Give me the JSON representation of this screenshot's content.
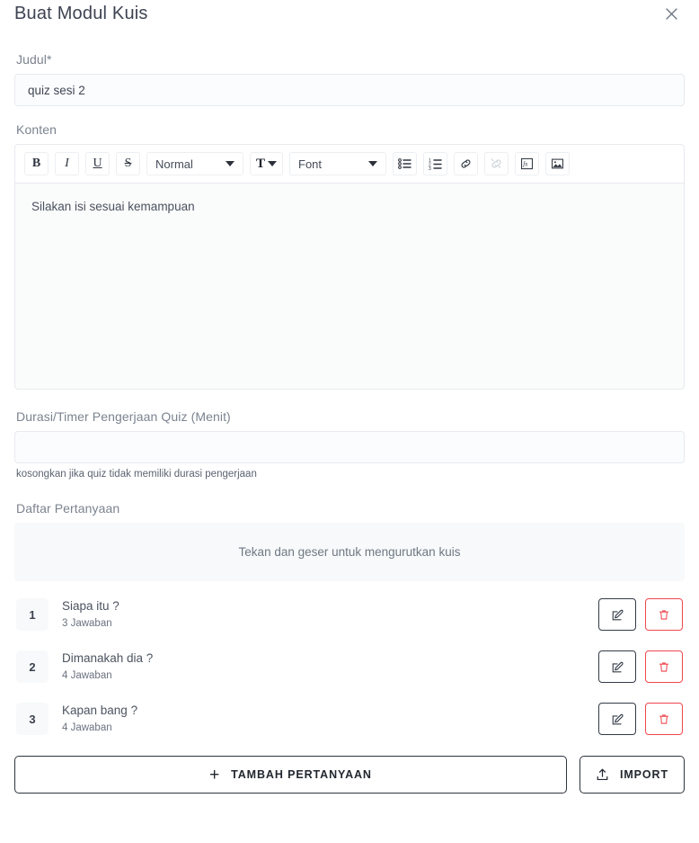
{
  "header": {
    "title": "Buat Modul Kuis",
    "close_label": "×",
    "close_icon": "close-icon"
  },
  "form": {
    "title_field": {
      "label": "Judul*",
      "value": "quiz sesi 2",
      "placeholder": ""
    },
    "content_field": {
      "label": "Konten",
      "value": "Silakan isi sesuai kemampuan"
    },
    "duration_field": {
      "label": "Durasi/Timer Pengerjaan Quiz (Menit)",
      "value": "",
      "placeholder": "",
      "helper": "kosongkan jika quiz tidak memiliki durasi pengerjaan"
    }
  },
  "editor_toolbar": {
    "bold": {
      "label": "B",
      "icon": "bold-icon"
    },
    "italic": {
      "label": "I",
      "icon": "italic-icon"
    },
    "underline": {
      "label": "U",
      "icon": "underline-icon"
    },
    "strike": {
      "label": "S",
      "icon": "strikethrough-icon"
    },
    "heading_select": {
      "value": "Normal",
      "icon": "chevron-down-icon"
    },
    "text_color": {
      "label": "T",
      "icon": "text-color-icon"
    },
    "font_select": {
      "value": "Font",
      "icon": "chevron-down-icon"
    },
    "bullet_list": {
      "icon": "bullet-list-icon"
    },
    "ordered_list": {
      "icon": "ordered-list-icon"
    },
    "link": {
      "icon": "link-icon"
    },
    "unlink": {
      "icon": "unlink-icon",
      "disabled": true
    },
    "formula": {
      "icon": "formula-icon"
    },
    "image": {
      "icon": "image-icon"
    }
  },
  "questions_section": {
    "label": "Daftar Pertanyaan",
    "drag_hint": "Tekan dan geser untuk mengurutkan kuis",
    "items": [
      {
        "number": "1",
        "title": "Siapa itu ?",
        "answers": "3 Jawaban",
        "edit_icon": "edit-icon",
        "delete_icon": "trash-icon"
      },
      {
        "number": "2",
        "title": "Dimanakah dia ?",
        "answers": "4 Jawaban",
        "edit_icon": "edit-icon",
        "delete_icon": "trash-icon"
      },
      {
        "number": "3",
        "title": "Kapan bang ?",
        "answers": "4 Jawaban",
        "edit_icon": "edit-icon",
        "delete_icon": "trash-icon"
      }
    ]
  },
  "footer": {
    "add_question": {
      "label": "TAMBAH PERTANYAAN",
      "icon": "plus-icon"
    },
    "import": {
      "label": "IMPORT",
      "icon": "upload-icon"
    }
  },
  "colors": {
    "title": "#3d4352",
    "label": "#7b838f",
    "danger": "#f0474f",
    "dark": "#2d333d",
    "surface": "#f7f9fa"
  }
}
